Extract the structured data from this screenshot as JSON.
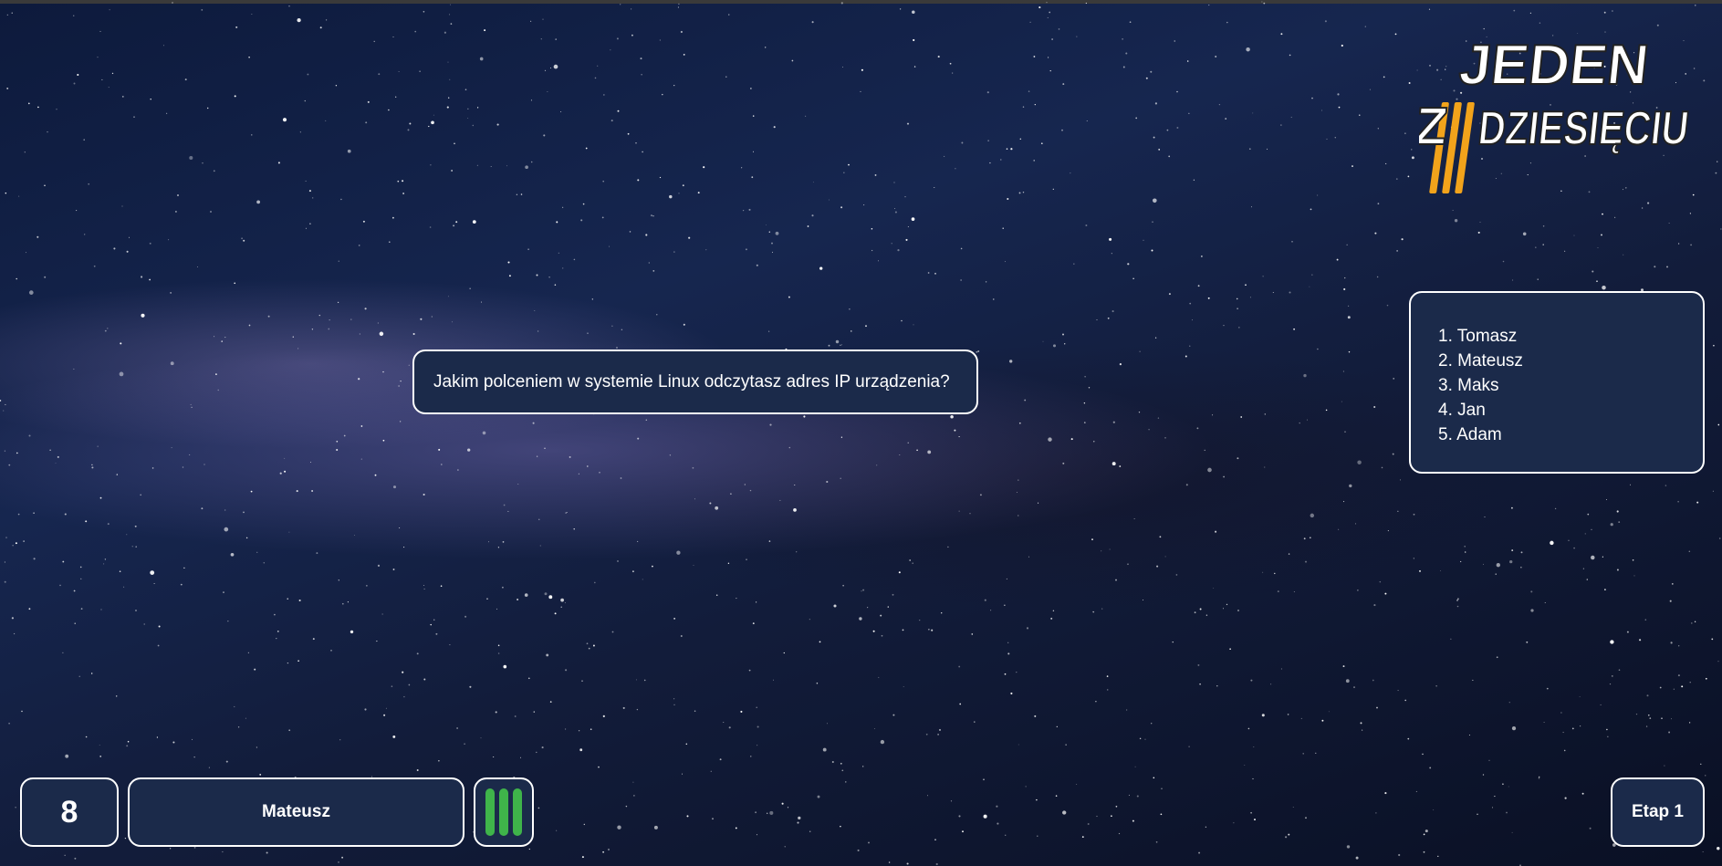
{
  "game": {
    "logo_text": "JEDEN Z DZIESIĘCIU",
    "question": "Jakim polceniem w systemie Linux odczytasz adres IP urządzenia?",
    "ranking": [
      "1. Tomasz",
      "2. Mateusz",
      "3. Maks",
      "4. Jan",
      "5. Adam"
    ],
    "score": "8",
    "player_name": "Mateusz",
    "lives_remaining": 3,
    "stage_label": "Etap 1"
  },
  "colors": {
    "panel_bg": "#1b2a4a",
    "panel_border": "#ffffff",
    "life_green": "#3fb44a",
    "logo_orange": "#f2a31b",
    "background": "#16264f"
  },
  "icons": {
    "lives": "life-bar-icon",
    "logo": "jeden-z-dziesieciu-logo"
  }
}
